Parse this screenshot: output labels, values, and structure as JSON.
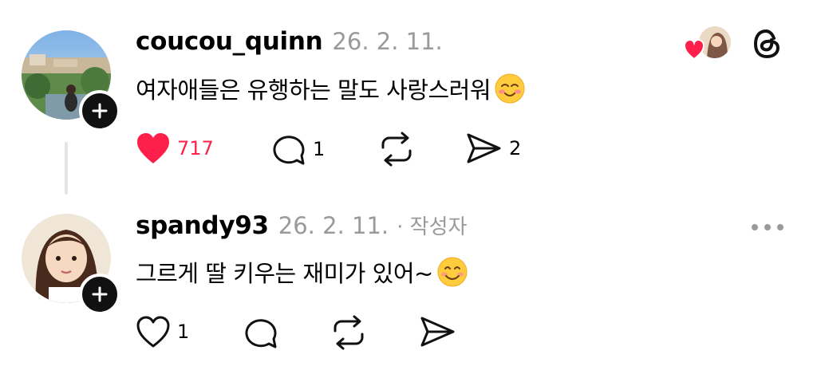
{
  "post": {
    "username": "coucou_quinn",
    "date": "26. 2. 11.",
    "text": "여자애들은 유행하는 말도 사랑스러워",
    "emoji": "relieved-face",
    "likes": "717",
    "replies": "1",
    "shares": "2",
    "like_color": "#ff1f4b"
  },
  "reply": {
    "username": "spandy93",
    "date": "26. 2. 11.",
    "author_tag": "· 작성자",
    "text": "그르게 딸 키우는 재미가 있어~",
    "emoji": "smiling-face",
    "likes": "1"
  },
  "icons": {
    "brand": "threads-icon",
    "menu": "more-icon",
    "liked_by": "liked-by-avatar"
  }
}
